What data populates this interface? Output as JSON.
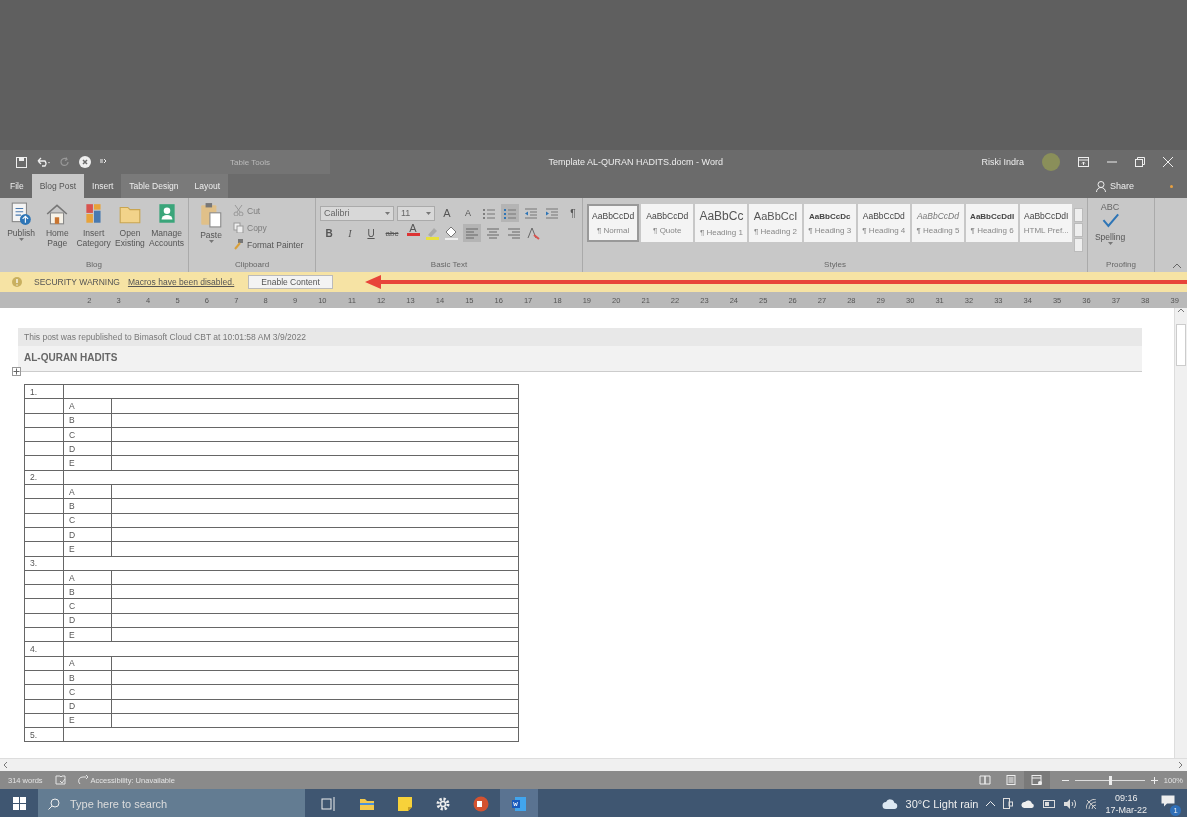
{
  "title_bar": {
    "context_group": "Table Tools",
    "document_title": "Template AL-QURAN HADITS.docm  -  Word",
    "user_name": "Riski Indra"
  },
  "tabs": [
    {
      "label": "File",
      "selected": false,
      "contextual": false
    },
    {
      "label": "Blog Post",
      "selected": true,
      "contextual": false
    },
    {
      "label": "Insert",
      "selected": false,
      "contextual": false
    },
    {
      "label": "Table Design",
      "selected": false,
      "contextual": true
    },
    {
      "label": "Layout",
      "selected": false,
      "contextual": true
    }
  ],
  "share": "Share",
  "ribbon_groups": [
    {
      "name": "Blog",
      "kind": "blog",
      "buttons": [
        {
          "label": "Publish"
        },
        {
          "label": "Home Page"
        },
        {
          "label": "Insert Category"
        },
        {
          "label": "Open Existing"
        },
        {
          "label": "Manage Accounts"
        }
      ]
    },
    {
      "name": "Clipboard",
      "kind": "clipboard",
      "paste": "Paste",
      "small": [
        {
          "label": "Cut",
          "disabled": true
        },
        {
          "label": "Copy",
          "disabled": true
        },
        {
          "label": "Format Painter",
          "disabled": false
        }
      ]
    },
    {
      "name": "Basic Text",
      "kind": "text",
      "font": "Calibri",
      "size": "11",
      "size_buttons": [
        {
          "label": "A",
          "kind": "grow"
        },
        {
          "label": "A",
          "kind": "shrink"
        }
      ],
      "list_buttons": [
        {
          "kind": "bullets",
          "selected": false
        },
        {
          "kind": "numbering",
          "selected": true
        },
        {
          "kind": "outdent",
          "selected": false
        },
        {
          "kind": "indent",
          "selected": false
        }
      ],
      "marks": "¶",
      "format_buttons": [
        {
          "label": "B",
          "kind": "bold"
        },
        {
          "label": "I",
          "kind": "italic"
        },
        {
          "label": "U",
          "kind": "underline"
        },
        {
          "label": "abc",
          "kind": "strike"
        }
      ],
      "font_color": "A",
      "align_buttons": [
        {
          "kind": "left",
          "selected": true
        },
        {
          "kind": "center",
          "selected": false
        },
        {
          "kind": "right",
          "selected": false
        }
      ]
    },
    {
      "name": "Styles",
      "kind": "styles",
      "styles": [
        {
          "sample": "AaBbCcDd",
          "label": "¶ Normal",
          "kind": "plain",
          "selected": true
        },
        {
          "sample": "AaBbCcDd",
          "label": "¶ Quote",
          "kind": "plain",
          "selected": false
        },
        {
          "sample": "AaBbCc",
          "label": "¶ Heading 1",
          "kind": "large",
          "selected": false
        },
        {
          "sample": "AaBbCcI",
          "label": "¶ Heading 2",
          "kind": "medium",
          "selected": false
        },
        {
          "sample": "AaBbCcDc",
          "label": "¶ Heading 3",
          "kind": "bold",
          "selected": false
        },
        {
          "sample": "AaBbCcDd",
          "label": "¶ Heading 4",
          "kind": "plain",
          "selected": false
        },
        {
          "sample": "AaBbCcDd",
          "label": "¶ Heading 5",
          "kind": "italic",
          "selected": false
        },
        {
          "sample": "AaBbCcDdI",
          "label": "¶ Heading 6",
          "kind": "bold",
          "selected": false
        },
        {
          "sample": "AaBbCcDdI",
          "label": "HTML Pref...",
          "kind": "plain",
          "selected": false
        }
      ]
    },
    {
      "name": "Proofing",
      "kind": "proofing",
      "buttons": [
        {
          "label": "Spelling",
          "caption": "ABC"
        }
      ]
    }
  ],
  "security_bar": {
    "title": "SECURITY WARNING",
    "message": "Macros have been disabled.",
    "button": "Enable Content"
  },
  "ruler": {
    "numbers": [
      "2",
      "3",
      "4",
      "5",
      "6",
      "7",
      "8",
      "9",
      "10",
      "11",
      "12",
      "13",
      "14",
      "15",
      "16",
      "17",
      "18",
      "19",
      "20",
      "21",
      "22",
      "23",
      "24",
      "25",
      "26",
      "27",
      "28",
      "29",
      "30",
      "31",
      "32",
      "33",
      "34",
      "35",
      "36",
      "37",
      "38",
      "39"
    ]
  },
  "document": {
    "notice": "This post was republished to Bimasoft Cloud CBT at 10:01:58 AM 3/9/2022",
    "title": "AL-QURAN HADITS",
    "questions": [
      {
        "number": "1.",
        "options": [
          "A",
          "B",
          "C",
          "D",
          "E"
        ]
      },
      {
        "number": "2.",
        "options": [
          "A",
          "B",
          "C",
          "D",
          "E"
        ]
      },
      {
        "number": "3.",
        "options": [
          "A",
          "B",
          "C",
          "D",
          "E"
        ]
      },
      {
        "number": "4.",
        "options": [
          "A",
          "B",
          "C",
          "D",
          "E"
        ]
      },
      {
        "number": "5."
      }
    ]
  },
  "status_bar": {
    "words": "314 words",
    "accessibility": "Accessibility: Unavailable",
    "views": [
      {
        "kind": "read",
        "selected": false
      },
      {
        "kind": "print",
        "selected": false
      },
      {
        "kind": "web",
        "selected": true
      }
    ],
    "zoom": {
      "level": 0.5,
      "reading": "100%"
    }
  },
  "taskbar": {
    "search_placeholder": "Type here to search",
    "apps": [
      {
        "kind": "task-view",
        "selected": false
      },
      {
        "kind": "explorer",
        "selected": false
      },
      {
        "kind": "notes",
        "selected": false
      },
      {
        "kind": "settings",
        "selected": false
      },
      {
        "kind": "powerpoint",
        "selected": false
      },
      {
        "kind": "word",
        "selected": true
      }
    ],
    "weather": "30°C  Light rain",
    "time": "09:16",
    "date": "17-Mar-22",
    "notifications": "1"
  }
}
